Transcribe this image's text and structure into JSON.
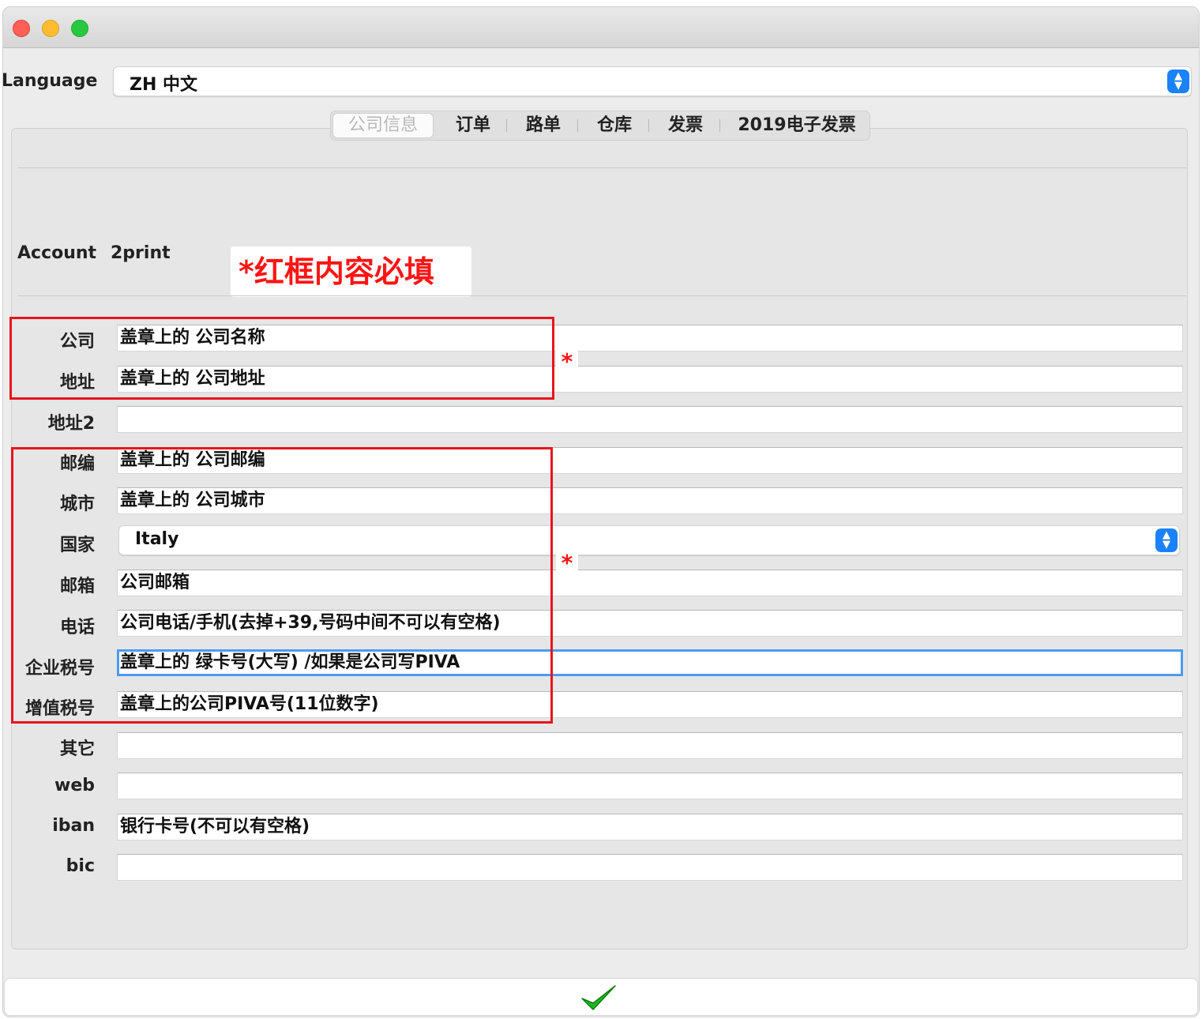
{
  "window": {
    "close_icon": "close-traffic-light",
    "minimize_icon": "minimize-traffic-light",
    "zoom_icon": "zoom-traffic-light"
  },
  "language": {
    "label": "Language",
    "value": "ZH 中文"
  },
  "tabs": [
    {
      "label": "公司信息",
      "active": true
    },
    {
      "label": "订单",
      "active": false
    },
    {
      "label": "路单",
      "active": false
    },
    {
      "label": "仓库",
      "active": false
    },
    {
      "label": "发票",
      "active": false
    },
    {
      "label": "2019电子发票",
      "active": false
    }
  ],
  "account": {
    "label": "Account",
    "value": "2print"
  },
  "note": "*红框内容必填",
  "required_marker": "*",
  "fields": {
    "company": {
      "label": "公司",
      "value": "盖章上的 公司名称"
    },
    "address": {
      "label": "地址",
      "value": "盖章上的 公司地址"
    },
    "address2": {
      "label": "地址2",
      "value": ""
    },
    "zip": {
      "label": "邮编",
      "value": "盖章上的 公司邮编"
    },
    "city": {
      "label": "城市",
      "value": "盖章上的 公司城市"
    },
    "country": {
      "label": "国家",
      "value": "Italy"
    },
    "email": {
      "label": "邮箱",
      "value": "公司邮箱"
    },
    "phone": {
      "label": "电话",
      "value": "公司电话/手机(去掉+39,号码中间不可以有空格)"
    },
    "tax_code": {
      "label": "企业税号",
      "value": "盖章上的 绿卡号(大写)  /如果是公司写PIVA"
    },
    "vat": {
      "label": "增值税号",
      "value": "盖章上的公司PIVA号(11位数字)"
    },
    "other": {
      "label": "其它",
      "value": ""
    },
    "web": {
      "label": "web",
      "value": ""
    },
    "iban": {
      "label": "iban",
      "value": "银行卡号(不可以有空格)"
    },
    "bic": {
      "label": "bic",
      "value": ""
    }
  },
  "confirm_icon": "checkmark-icon",
  "colors": {
    "annotation_red": "#e8141e",
    "accent_blue": "#1a82fb",
    "confirm_green": "#1fb81f"
  }
}
